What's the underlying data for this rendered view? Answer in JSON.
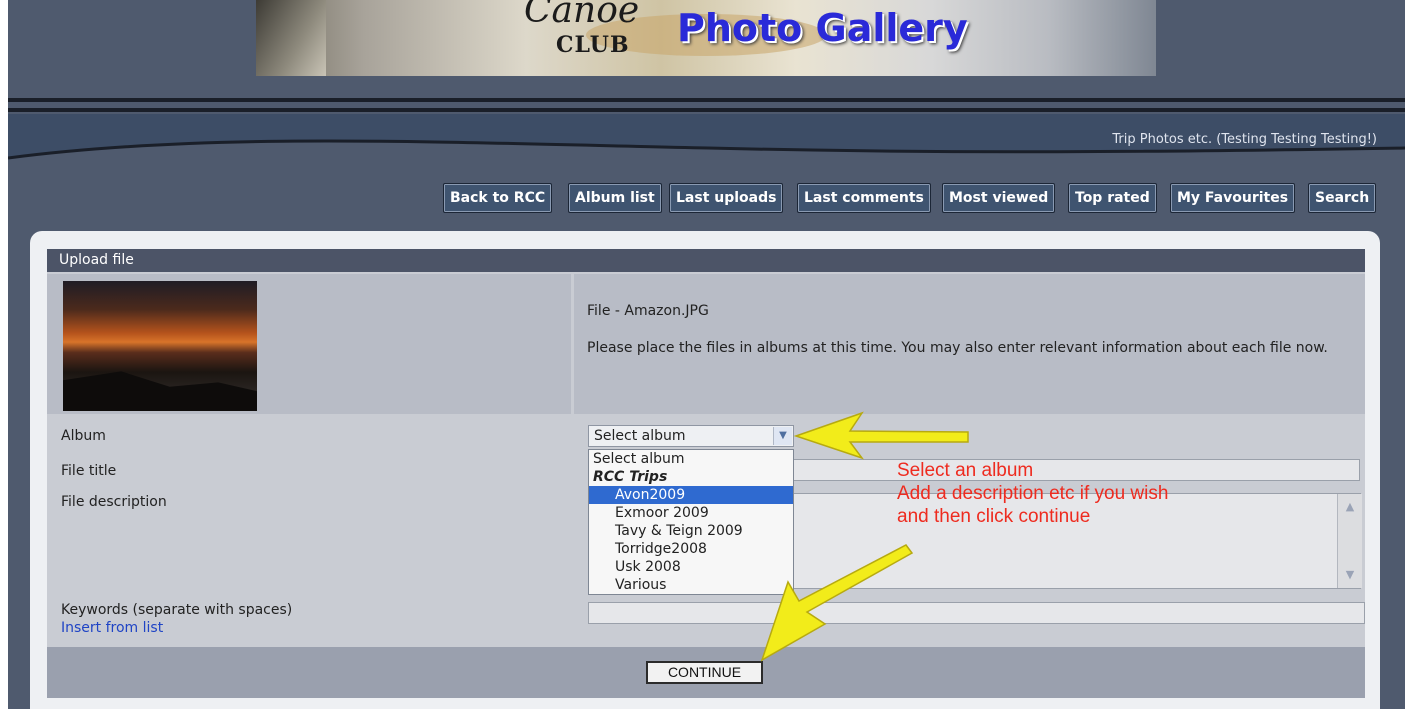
{
  "banner": {
    "script_text": "Canoe",
    "club_text": "CLUB",
    "title": "Photo Gallery"
  },
  "tagline": "Trip Photos etc. (Testing Testing Testing!)",
  "nav": [
    {
      "label": "Back to RCC"
    },
    {
      "label": "Album list"
    },
    {
      "label": "Last uploads"
    },
    {
      "label": "Last comments"
    },
    {
      "label": "Most viewed"
    },
    {
      "label": "Top rated"
    },
    {
      "label": "My Favourites"
    },
    {
      "label": "Search"
    }
  ],
  "upload": {
    "header": "Upload file",
    "file_line": "File - Amazon.JPG",
    "info_text": "Please place the files in albums at this time. You may also enter relevant information about each file now.",
    "labels": {
      "album": "Album",
      "file_title": "File title",
      "file_description": "File description",
      "keywords": "Keywords (separate with spaces)",
      "insert_from_list": "Insert from list"
    },
    "album_selected": "Select album",
    "album_options": [
      {
        "label": "Select album",
        "kind": "plain"
      },
      {
        "label": "RCC Trips",
        "kind": "group"
      },
      {
        "label": "Avon2009",
        "kind": "child",
        "selected": true
      },
      {
        "label": "Exmoor 2009",
        "kind": "child"
      },
      {
        "label": "Tavy & Teign 2009",
        "kind": "child"
      },
      {
        "label": "Torridge2008",
        "kind": "child"
      },
      {
        "label": "Usk 2008",
        "kind": "child"
      },
      {
        "label": "Various",
        "kind": "child"
      }
    ],
    "continue_label": "CONTINUE"
  },
  "annotation": {
    "line1": "Select an album",
    "line2": "Add a description etc if you wish",
    "line3": "and then click continue",
    "color": "#ee2b1f",
    "arrow_color": "#f2ec1a"
  },
  "colors": {
    "nav_bg": "#3f5470",
    "header_bg": "#4c5467",
    "selected_option": "#2f6ad0",
    "link": "#1f44c5"
  }
}
